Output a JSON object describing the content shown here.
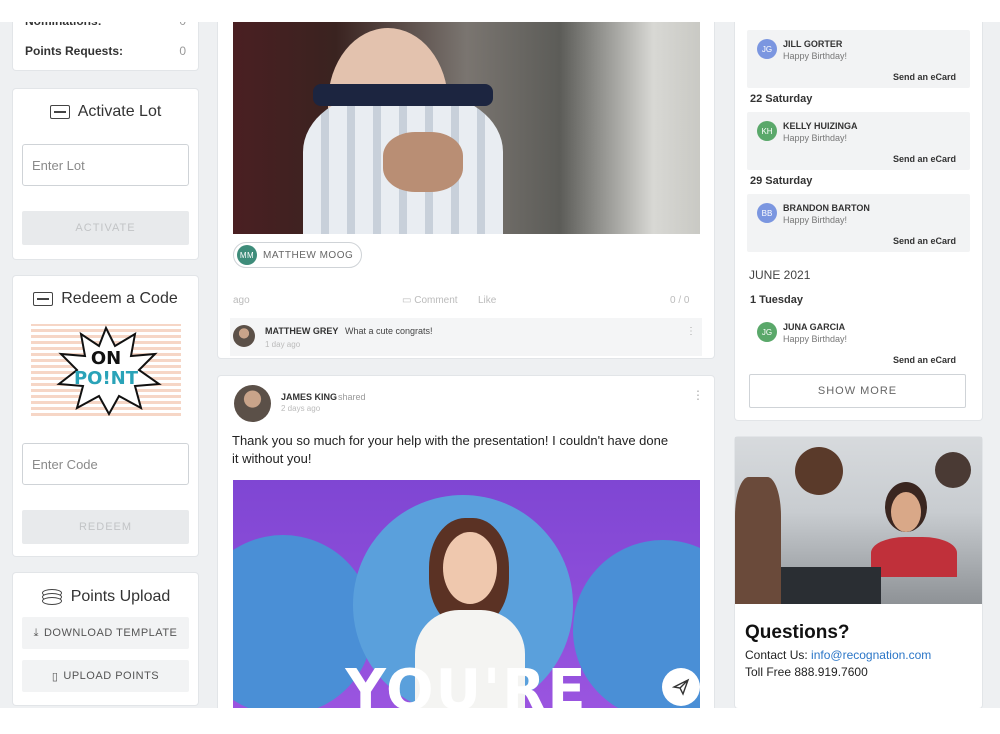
{
  "left": {
    "stats": [
      {
        "label": "Nominations:",
        "value": "0"
      },
      {
        "label": "Points Requests:",
        "value": "0"
      }
    ],
    "activate": {
      "title": "Activate Lot",
      "placeholder": "Enter Lot",
      "button": "ACTIVATE"
    },
    "redeem": {
      "title": "Redeem a Code",
      "logo_line1": "ON",
      "logo_line2": "PO!NT",
      "placeholder": "Enter Code",
      "button": "REDEEM"
    },
    "upload": {
      "title": "Points Upload",
      "download": "DOWNLOAD TEMPLATE",
      "upload": "UPLOAD POINTS"
    }
  },
  "feed": {
    "post1": {
      "mention_initials": "MM",
      "mention_name": "MATTHEW MOOG",
      "meta_left": "ago",
      "meta_comment": "Comment",
      "meta_like": "Like",
      "meta_right": "0 / 0",
      "comment_author": "MATTHEW GREY",
      "comment_text": "What a cute congrats!",
      "comment_time": "1 day ago"
    },
    "post2": {
      "author": "JAMES KING",
      "action": "shared",
      "time": "2 days ago",
      "body": "Thank you so much for your help with the presentation! I couldn't have done it without you!",
      "gif_text": "YOU'RE"
    }
  },
  "right": {
    "birthdays": [
      {
        "date": "",
        "initials": "JG",
        "name": "JILL GORTER",
        "msg": "Happy Birthday!",
        "action": "Send an eCard",
        "color": "#7b96e0"
      },
      {
        "date": "22 Saturday",
        "initials": "KH",
        "name": "KELLY HUIZINGA",
        "msg": "Happy Birthday!",
        "action": "Send an eCard",
        "color": "#5aa86a"
      },
      {
        "date": "29 Saturday",
        "initials": "BB",
        "name": "BRANDON BARTON",
        "msg": "Happy Birthday!",
        "action": "Send an eCard",
        "color": "#7b96e0"
      },
      {
        "date": "1 Tuesday",
        "initials": "JG",
        "name": "JUNA GARCIA",
        "msg": "Happy Birthday!",
        "action": "Send an eCard",
        "color": "#5aa86a"
      }
    ],
    "month": "JUNE 2021",
    "show_more": "SHOW MORE",
    "questions": {
      "title": "Questions?",
      "contact_label": "Contact Us:",
      "email": "info@recognation.com",
      "phone": "Toll Free 888.919.7600"
    }
  }
}
